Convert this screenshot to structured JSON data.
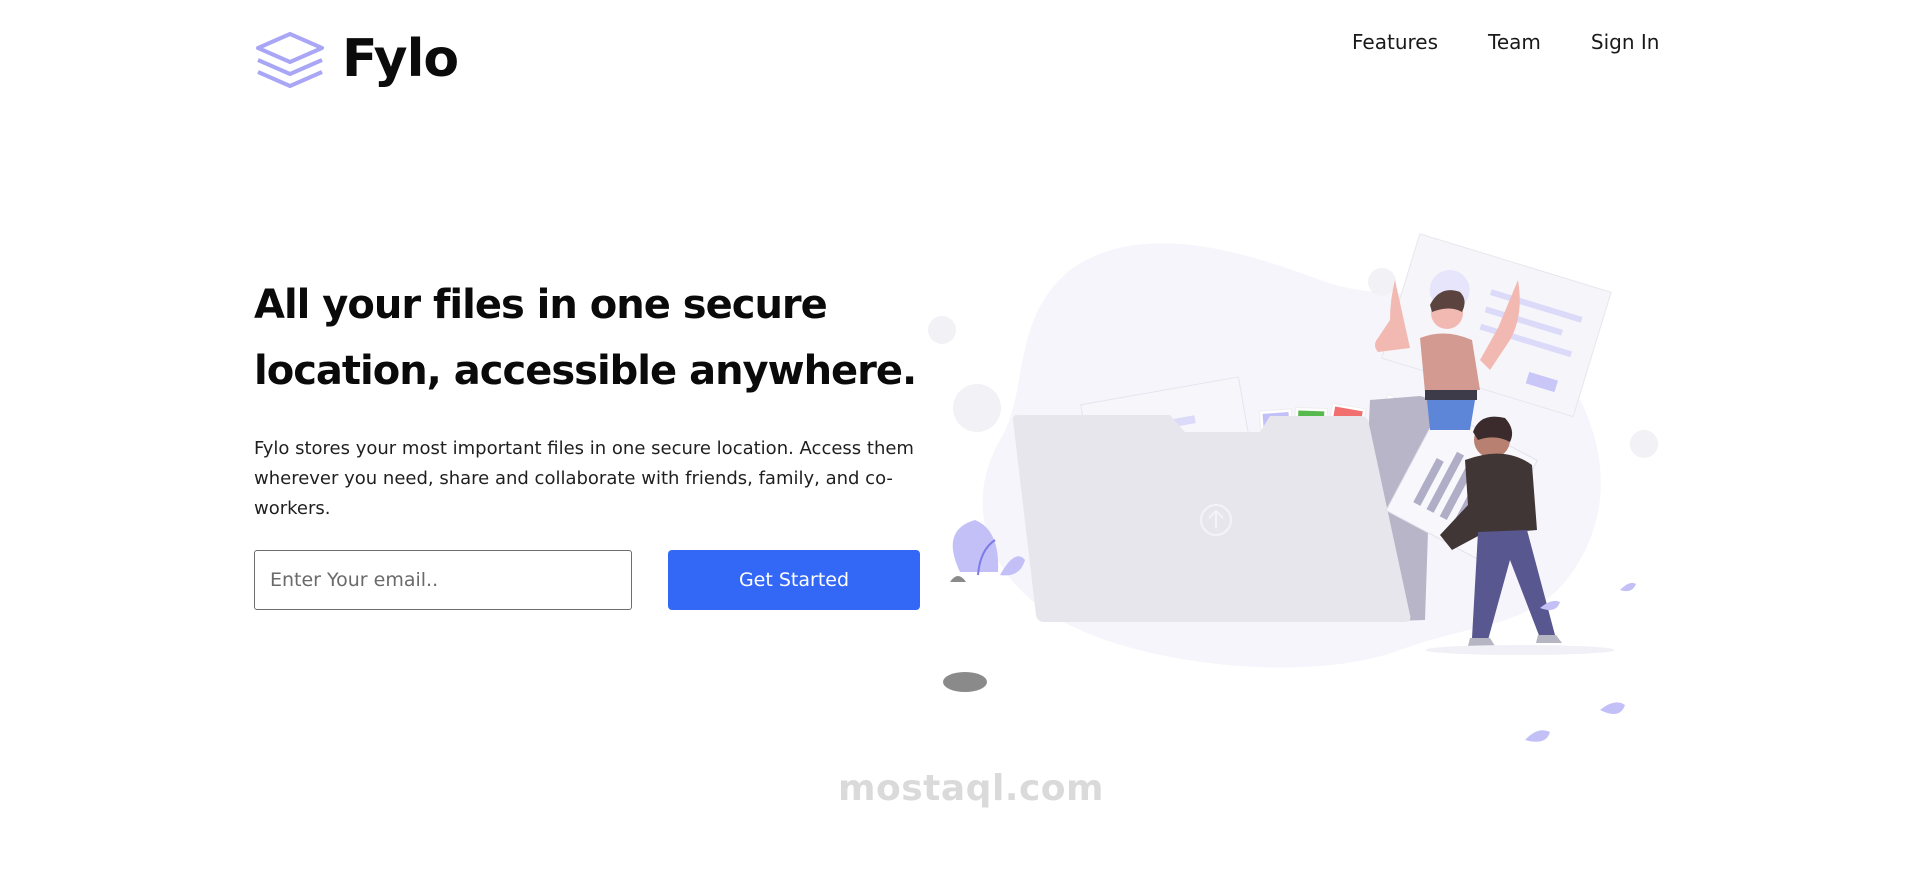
{
  "brand": {
    "name": "Fylo",
    "logo_icon": "layers-icon",
    "accent_color": "#3367f6",
    "logo_color": "#a9a6f6"
  },
  "nav": {
    "items": [
      {
        "label": "Features"
      },
      {
        "label": "Team"
      },
      {
        "label": "Sign In"
      }
    ]
  },
  "hero": {
    "headline": "All your files in one secure location, accessible anywhere.",
    "description": "Fylo stores your most important files in one secure location. Access them wherever you need, share and collaborate with friends, family, and co-workers.",
    "email_placeholder": "Enter Your email..",
    "cta_label": "Get Started"
  },
  "illustration": {
    "name": "file-sharing-illustration"
  },
  "watermark": {
    "text": "mostaql.com",
    "logo": "mostaql-logo"
  }
}
